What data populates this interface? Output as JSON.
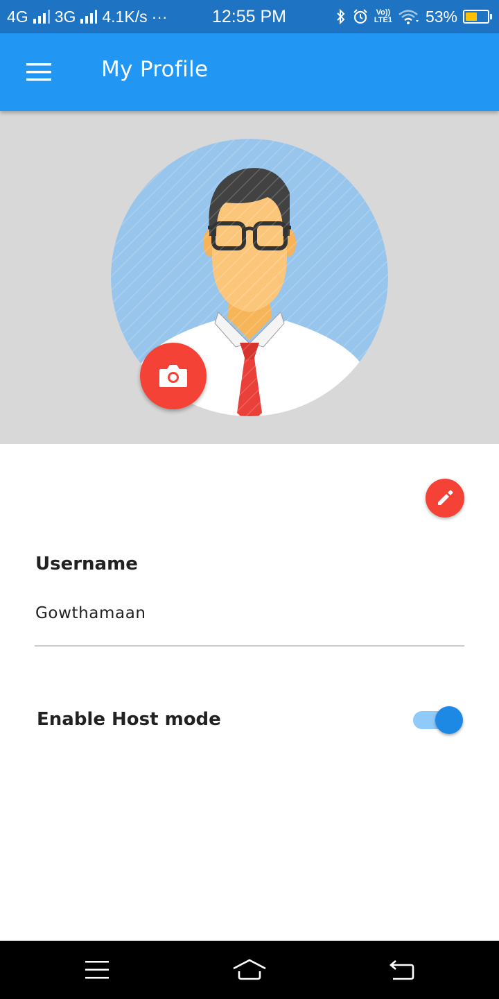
{
  "status_bar": {
    "network_1": "4G",
    "network_2": "3G",
    "speed": "4.1K/s",
    "more": "···",
    "time": "12:55 PM",
    "volte_top": "Vo))",
    "volte_bottom": "LTE1",
    "battery_percent": "53%",
    "battery_level": 0.53,
    "battery_color": "#ffc107"
  },
  "app_bar": {
    "title": "My Profile",
    "menu_icon": "hamburger-menu-icon",
    "color": "#2196f3"
  },
  "profile": {
    "avatar_icon": "male-avatar-illustration",
    "camera_icon": "camera-icon",
    "edit_icon": "pencil-icon",
    "accent": "#f44336"
  },
  "form": {
    "username_label": "Username",
    "username_value": "Gowthamaan",
    "host_mode_label": "Enable Host mode",
    "host_mode_enabled": true
  },
  "nav_bar": {
    "menu_icon": "menu-icon",
    "home_icon": "home-icon",
    "back_icon": "back-icon"
  }
}
